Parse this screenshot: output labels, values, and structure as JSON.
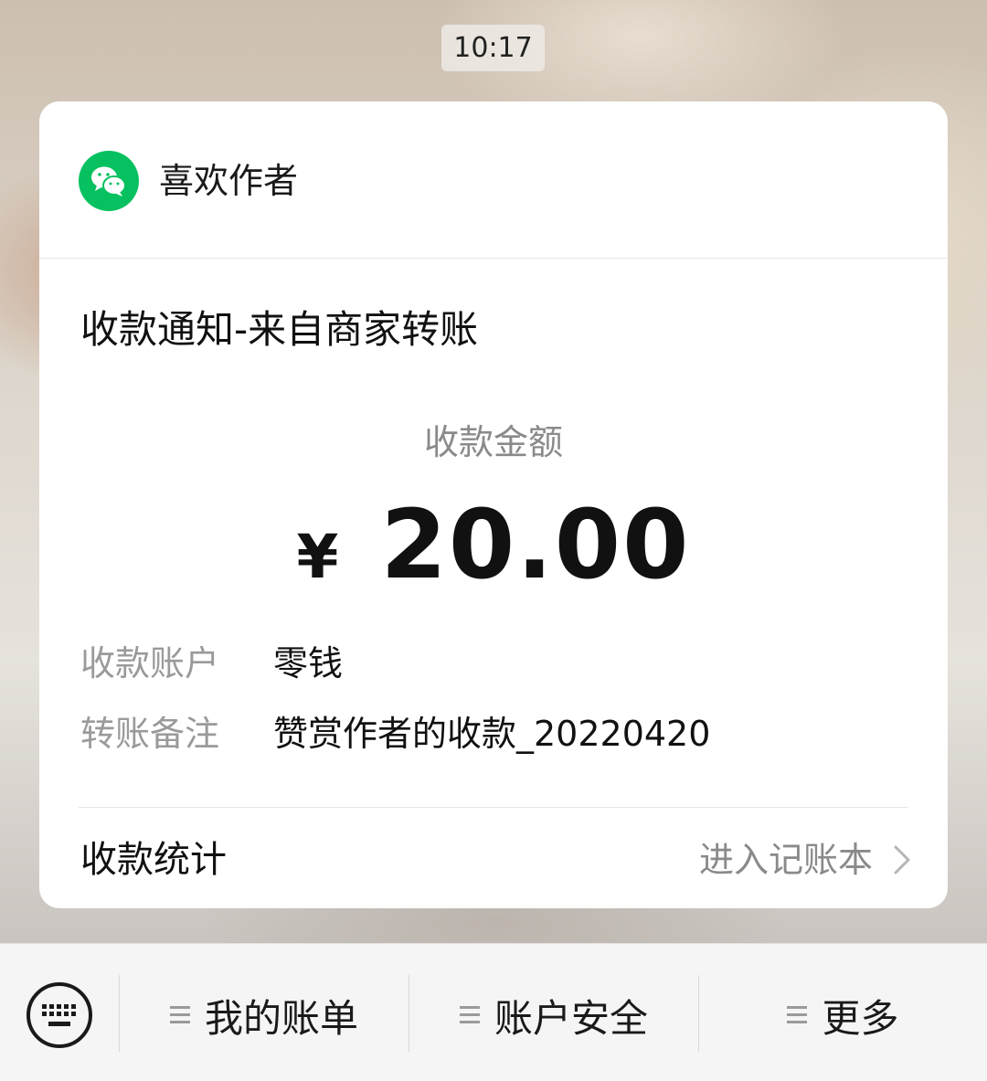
{
  "status": {
    "time": "10:17"
  },
  "card": {
    "app_name": "喜欢作者",
    "title": "收款通知-来自商家转账",
    "amount_label": "收款金额",
    "currency": "¥",
    "amount": "20.00",
    "rows": [
      {
        "label": "收款账户",
        "value": "零钱"
      },
      {
        "label": "转账备注",
        "value": "赞赏作者的收款_20220420"
      }
    ],
    "stats_label": "收款统计",
    "stats_link": "进入记账本"
  },
  "bottom_menu": {
    "items": [
      {
        "label": "我的账单"
      },
      {
        "label": "账户安全"
      },
      {
        "label": "更多"
      }
    ]
  },
  "colors": {
    "brand_green": "#07c160",
    "card_bg": "#ffffff",
    "muted_text": "#8a8a8a"
  }
}
